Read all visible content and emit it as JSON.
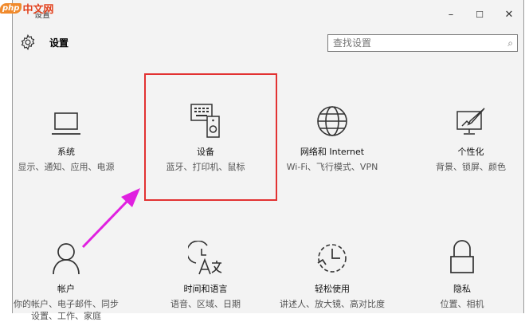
{
  "window": {
    "title": "设置",
    "minimize": "–",
    "maximize": "☐",
    "close": "✕"
  },
  "watermark": {
    "php": "php",
    "cn": "中文网"
  },
  "header": {
    "title": "设置"
  },
  "search": {
    "placeholder": "查找设置"
  },
  "tiles": [
    {
      "title": "系统",
      "desc": "显示、通知、应用、电源",
      "icon": "laptop-icon"
    },
    {
      "title": "设备",
      "desc": "蓝牙、打印机、鼠标",
      "icon": "devices-icon"
    },
    {
      "title": "网络和 Internet",
      "desc": "Wi-Fi、飞行模式、VPN",
      "icon": "globe-icon"
    },
    {
      "title": "个性化",
      "desc": "背景、锁屏、颜色",
      "icon": "personalization-icon"
    },
    {
      "title": "帐户",
      "desc": "你的帐户、电子邮件、同步设置、工作、家庭",
      "icon": "person-icon"
    },
    {
      "title": "时间和语言",
      "desc": "语音、区域、日期",
      "icon": "time-language-icon"
    },
    {
      "title": "轻松使用",
      "desc": "讲述人、放大镜、高对比度",
      "icon": "ease-of-access-icon"
    },
    {
      "title": "隐私",
      "desc": "位置、相机",
      "icon": "lock-icon"
    }
  ],
  "colors": {
    "highlight": "#e23232",
    "arrow": "#e020e0"
  }
}
